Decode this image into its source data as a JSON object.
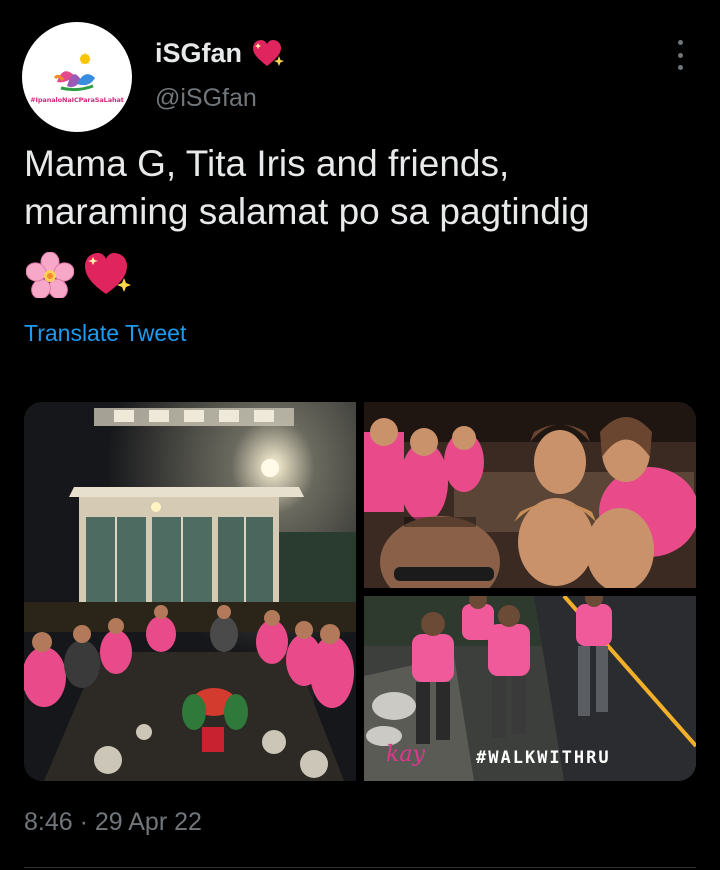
{
  "author": {
    "display_name": "iSGfan",
    "handle": "@iSGfan",
    "avatar_caption": "#IpanaloNaICParaSaLahat"
  },
  "tweet": {
    "text_line1": "Mama G, Tita Iris and friends,",
    "text_line2": "maraming salamat po sa pagtindig",
    "emojis": [
      "cherry-blossom-icon",
      "sparkling-heart-icon"
    ],
    "translate_label": "Translate Tweet",
    "timestamp": "8:46 · 29 Apr 22"
  },
  "media": {
    "photo_count": 3,
    "walk_hashtag": "#WALKWITHRU",
    "signature_text": "kay"
  },
  "colors": {
    "background": "#000000",
    "text": "#e7e9ea",
    "muted": "#71767b",
    "link": "#1d9bf0",
    "shirt_pink": "#e94b8a"
  }
}
